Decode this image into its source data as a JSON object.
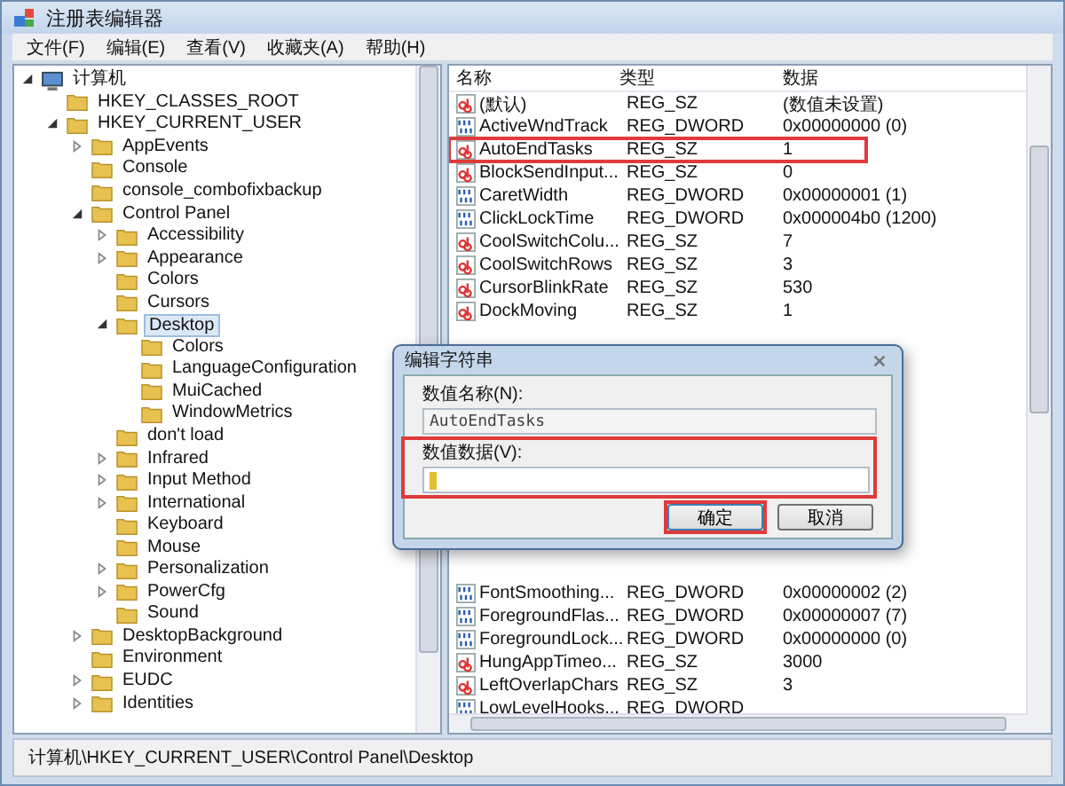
{
  "window": {
    "title": "注册表编辑器"
  },
  "menu": [
    "文件(F)",
    "编辑(E)",
    "查看(V)",
    "收藏夹(A)",
    "帮助(H)"
  ],
  "tree": [
    {
      "label": "计算机",
      "kind": "computer",
      "expanded": true,
      "selected": false,
      "children": [
        {
          "label": "HKEY_CLASSES_ROOT",
          "kind": "folder",
          "selected": false
        },
        {
          "label": "HKEY_CURRENT_USER",
          "kind": "folder",
          "expanded": true,
          "selected": false,
          "children": [
            {
              "label": "AppEvents",
              "kind": "folder",
              "expanded": false,
              "selected": false
            },
            {
              "label": "Console",
              "kind": "folder",
              "selected": false
            },
            {
              "label": "console_combofixbackup",
              "kind": "folder",
              "selected": false
            },
            {
              "label": "Control Panel",
              "kind": "folder",
              "expanded": true,
              "selected": false,
              "children": [
                {
                  "label": "Accessibility",
                  "kind": "folder",
                  "expanded": false,
                  "selected": false
                },
                {
                  "label": "Appearance",
                  "kind": "folder",
                  "expanded": false,
                  "selected": false
                },
                {
                  "label": "Colors",
                  "kind": "folder",
                  "selected": false
                },
                {
                  "label": "Cursors",
                  "kind": "folder",
                  "selected": false
                },
                {
                  "label": "Desktop",
                  "kind": "folder",
                  "expanded": true,
                  "selected": true,
                  "children": [
                    {
                      "label": "Colors",
                      "kind": "folder",
                      "selected": false
                    },
                    {
                      "label": "LanguageConfiguration",
                      "kind": "folder",
                      "selected": false
                    },
                    {
                      "label": "MuiCached",
                      "kind": "folder",
                      "selected": false
                    },
                    {
                      "label": "WindowMetrics",
                      "kind": "folder",
                      "selected": false
                    }
                  ]
                },
                {
                  "label": "don't load",
                  "kind": "folder",
                  "selected": false
                },
                {
                  "label": "Infrared",
                  "kind": "folder",
                  "expanded": false,
                  "selected": false
                },
                {
                  "label": "Input Method",
                  "kind": "folder",
                  "expanded": false,
                  "selected": false
                },
                {
                  "label": "International",
                  "kind": "folder",
                  "expanded": false,
                  "selected": false
                },
                {
                  "label": "Keyboard",
                  "kind": "folder",
                  "selected": false
                },
                {
                  "label": "Mouse",
                  "kind": "folder",
                  "selected": false
                },
                {
                  "label": "Personalization",
                  "kind": "folder",
                  "expanded": false,
                  "selected": false
                },
                {
                  "label": "PowerCfg",
                  "kind": "folder",
                  "expanded": false,
                  "selected": false
                },
                {
                  "label": "Sound",
                  "kind": "folder",
                  "selected": false
                }
              ]
            },
            {
              "label": "DesktopBackground",
              "kind": "folder",
              "expanded": false,
              "selected": false
            },
            {
              "label": "Environment",
              "kind": "folder",
              "selected": false
            },
            {
              "label": "EUDC",
              "kind": "folder",
              "expanded": false,
              "selected": false
            },
            {
              "label": "Identities",
              "kind": "folder",
              "expanded": false,
              "selected": false
            }
          ]
        }
      ]
    }
  ],
  "table": {
    "columns": [
      "名称",
      "类型",
      "数据"
    ],
    "rows_above_dialog": [
      {
        "name": "(默认)",
        "kind": "string",
        "type": "REG_SZ",
        "data": "(数值未设置)",
        "highlighted": false
      },
      {
        "name": "ActiveWndTrack",
        "kind": "dword",
        "type": "REG_DWORD",
        "data": "0x00000000 (0)",
        "highlighted": false
      },
      {
        "name": "AutoEndTasks",
        "kind": "string",
        "type": "REG_SZ",
        "data": "1",
        "highlighted": true
      },
      {
        "name": "BlockSendInput...",
        "kind": "string",
        "type": "REG_SZ",
        "data": "0",
        "highlighted": false
      },
      {
        "name": "CaretWidth",
        "kind": "dword",
        "type": "REG_DWORD",
        "data": "0x00000001 (1)",
        "highlighted": false
      },
      {
        "name": "ClickLockTime",
        "kind": "dword",
        "type": "REG_DWORD",
        "data": "0x000004b0 (1200)",
        "highlighted": false
      },
      {
        "name": "CoolSwitchColu...",
        "kind": "string",
        "type": "REG_SZ",
        "data": "7",
        "highlighted": false
      },
      {
        "name": "CoolSwitchRows",
        "kind": "string",
        "type": "REG_SZ",
        "data": "3",
        "highlighted": false
      },
      {
        "name": "CursorBlinkRate",
        "kind": "string",
        "type": "REG_SZ",
        "data": "530",
        "highlighted": false
      },
      {
        "name": "DockMoving",
        "kind": "string",
        "type": "REG_SZ",
        "data": "1",
        "highlighted": false
      }
    ],
    "rows_below_dialog": [
      {
        "name": "FontSmoothing...",
        "kind": "dword",
        "type": "REG_DWORD",
        "data": "0x00000002 (2)",
        "highlighted": false
      },
      {
        "name": "ForegroundFlas...",
        "kind": "dword",
        "type": "REG_DWORD",
        "data": "0x00000007 (7)",
        "highlighted": false
      },
      {
        "name": "ForegroundLock...",
        "kind": "dword",
        "type": "REG_DWORD",
        "data": "0x00000000 (0)",
        "highlighted": false
      },
      {
        "name": "HungAppTimeo...",
        "kind": "string",
        "type": "REG_SZ",
        "data": "3000",
        "highlighted": false
      },
      {
        "name": "LeftOverlapChars",
        "kind": "string",
        "type": "REG_SZ",
        "data": "3",
        "highlighted": false
      },
      {
        "name": "LowLevelHooks...",
        "kind": "dword",
        "type": "REG_DWORD",
        "highlighted": false
      }
    ]
  },
  "dialog": {
    "title": "编辑字符串",
    "name_label": "数值名称(N):",
    "name_value": "AutoEndTasks",
    "data_label": "数值数据(V):",
    "data_highlighted": true,
    "buttons": [
      {
        "label": "确定",
        "highlighted": true
      },
      {
        "label": "取消",
        "highlighted": false
      }
    ]
  },
  "status_bar": "计算机\\HKEY_CURRENT_USER\\Control Panel\\Desktop"
}
